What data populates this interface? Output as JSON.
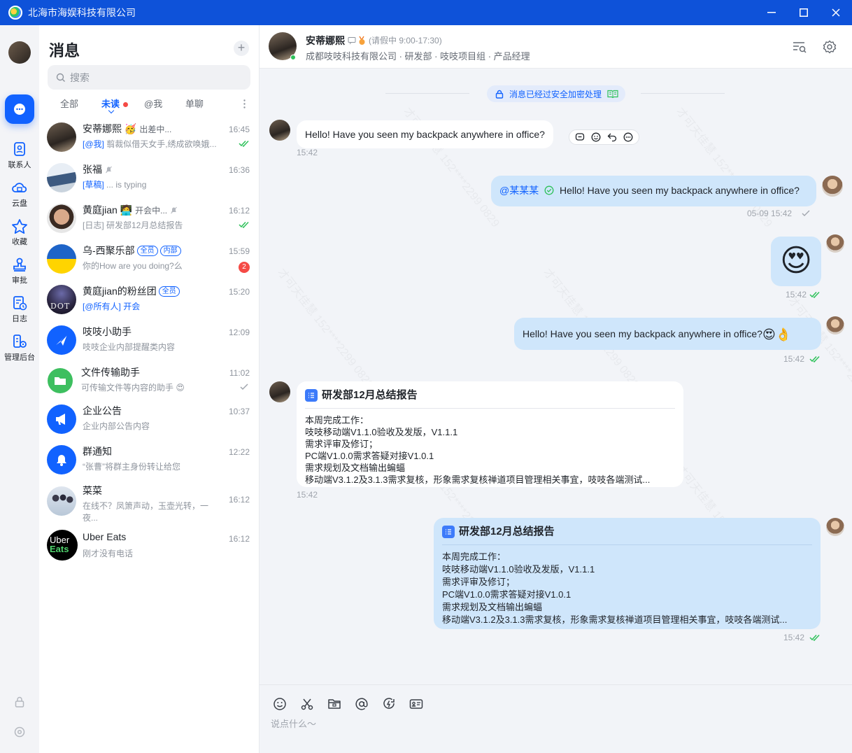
{
  "window": {
    "title": "北海市海娱科技有限公司"
  },
  "nav": {
    "items": [
      {
        "label": "联系人",
        "icon": "contacts-icon"
      },
      {
        "label": "云盘",
        "icon": "cloud-drive-icon"
      },
      {
        "label": "收藏",
        "icon": "star-icon"
      },
      {
        "label": "审批",
        "icon": "stamp-icon"
      },
      {
        "label": "日志",
        "icon": "log-icon"
      },
      {
        "label": "管理后台",
        "icon": "admin-icon"
      }
    ]
  },
  "conversations_panel": {
    "title": "消息",
    "search_placeholder": "搜索",
    "tabs": [
      "全部",
      "未读",
      "@我",
      "单聊"
    ],
    "active_tab": "未读",
    "items": [
      {
        "name": "安蒂娜熙",
        "status": "出差中...",
        "tag": "[@我]",
        "preview": " 翦裁似借天女手,绣成欲唤娥...",
        "time": "16:45",
        "read": "double-check"
      },
      {
        "name": "张福",
        "tag": "[草稿]",
        "preview": " ... is typing",
        "time": "16:36"
      },
      {
        "name": "黄庭jian",
        "status": "开会中...",
        "preview": "[日志] 研发部12月总结报告",
        "time": "16:12",
        "read": "double-check"
      },
      {
        "name": "乌-西聚乐部",
        "pills": [
          "全员",
          "内部"
        ],
        "preview": "你的How are you doing?么",
        "time": "15:59",
        "badge": "2"
      },
      {
        "name": "黄庭jian的粉丝团",
        "pills": [
          "全员"
        ],
        "tag": "[@所有人]",
        "preview": " 开会",
        "time": "15:20"
      },
      {
        "name": "吱吱小助手",
        "preview": "吱吱企业内部提醒类内容",
        "time": "12:09"
      },
      {
        "name": "文件传输助手",
        "preview": "可传输文件等内容的助手 😍",
        "time": "11:02",
        "read": "single-check"
      },
      {
        "name": "企业公告",
        "preview": "企业内部公告内容",
        "time": "10:37"
      },
      {
        "name": "群通知",
        "preview": "“张曹”将群主身份转让给您",
        "time": "12:22"
      },
      {
        "name": "菜菜",
        "preview": "在线不？凤箫声动，玉壶光转，一",
        "preview2": "夜...",
        "time": "16:12"
      },
      {
        "name": "Uber Eats",
        "preview": "刚才没有电话",
        "time": "16:12",
        "logo_text": [
          "Uber",
          "Eats"
        ]
      }
    ]
  },
  "chat": {
    "contact_name": "安蒂娜熙",
    "leave_status": "(请假中 9:00-17:30)",
    "org_path": "成都吱吱科技有限公司 · 研发部 · 吱吱项目组 · 产品经理",
    "secure_notice": "消息已经过安全加密处理",
    "messages": [
      {
        "from": "them",
        "text": "Hello! Have you seen my backpack anywhere in office?",
        "time": "15:42"
      },
      {
        "from": "me",
        "mention": "@某某某",
        "text": "Hello! Have you seen my backpack anywhere in office?",
        "time": "05-09 15:42"
      },
      {
        "from": "me",
        "emoji": "😍",
        "time": "15:42"
      },
      {
        "from": "me",
        "text": "Hello! Have you seen my backpack anywhere in office?",
        "emojis": "😍👌",
        "time": "15:42"
      },
      {
        "from": "them",
        "card_title": "研发部12月总结报告",
        "time": "15:42"
      },
      {
        "from": "me",
        "card_title": "研发部12月总结报告",
        "time": "15:42"
      }
    ],
    "card_lines": [
      "本周完成工作：",
      "吱吱移动端V1.1.0验收及发版，V1.1.1",
      "需求评审及修订；",
      "PC端V1.0.0需求答疑对接V1.0.1",
      "需求规划及文档输出蝙蝠",
      "移动端V3.1.2及3.1.3需求复核，形象需求复核禅道项目管理相关事宜，吱吱各端测试..."
    ],
    "composer_placeholder": "说点什么～",
    "watermark": "才可天佳慧 152****2299 0829"
  },
  "colors": {
    "accent": "#1162ff",
    "titlebar": "#0e52d9",
    "out_bubble": "#cfe6fb",
    "read_check": "#2ec15a"
  }
}
